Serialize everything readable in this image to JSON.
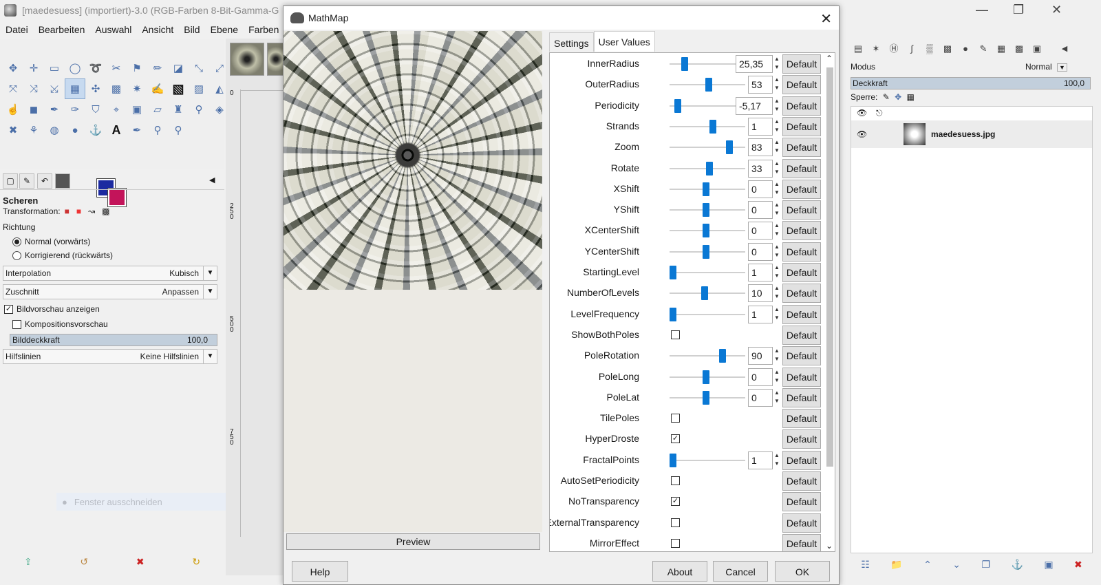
{
  "gimp": {
    "title": "[maedesuess] (importiert)-3.0 (RGB-Farben 8-Bit-Gamma-G",
    "menu": [
      "Datei",
      "Bearbeiten",
      "Auswahl",
      "Ansicht",
      "Bild",
      "Ebene",
      "Farben"
    ],
    "tool_options": {
      "header": "Scheren",
      "transformation_label": "Transformation:",
      "direction_label": "Richtung",
      "direction_options": [
        "Normal (vorwärts)",
        "Korrigierend (rückwärts)"
      ],
      "interpolation_label": "Interpolation",
      "interpolation_value": "Kubisch",
      "clip_label": "Zuschnitt",
      "clip_value": "Anpassen",
      "show_preview": "Bildvorschau anzeigen",
      "composite_preview": "Kompositionsvorschau",
      "opacity_label": "Bilddeckkraft",
      "opacity_value": "100,0",
      "guides_label": "Hilfslinien",
      "guides_value": "Keine Hilfslinien",
      "ghost_label": "Fenster ausschneiden"
    },
    "ruler_marks": [
      "0",
      "250",
      "500",
      "750"
    ],
    "fg_color": "#1c2aa0",
    "bg_color": "#c3145a"
  },
  "layers": {
    "mode_label": "Modus",
    "mode_value": "Normal",
    "opacity_label": "Deckkraft",
    "opacity_value": "100,0",
    "lock_label": "Sperre:",
    "layer_name": "maedesuess.jpg"
  },
  "dialog": {
    "title": "MathMap",
    "tabs": [
      "Settings",
      "User Values"
    ],
    "preview_button": "Preview",
    "help_button": "Help",
    "about_button": "About",
    "cancel_button": "Cancel",
    "ok_button": "OK",
    "default_label": "Default",
    "params": [
      {
        "label": "InnerRadius",
        "type": "slider",
        "value": "25,35",
        "pos": 0.17
      },
      {
        "label": "OuterRadius",
        "type": "slider",
        "value": "53",
        "pos": 0.52
      },
      {
        "label": "Periodicity",
        "type": "slider",
        "value": "-5,17",
        "pos": 0.07
      },
      {
        "label": "Strands",
        "type": "slider",
        "value": "1",
        "pos": 0.58
      },
      {
        "label": "Zoom",
        "type": "slider",
        "value": "83",
        "pos": 0.82
      },
      {
        "label": "Rotate",
        "type": "slider",
        "value": "33",
        "pos": 0.53
      },
      {
        "label": "XShift",
        "type": "slider",
        "value": "0",
        "pos": 0.48
      },
      {
        "label": "YShift",
        "type": "slider",
        "value": "0",
        "pos": 0.48
      },
      {
        "label": "XCenterShift",
        "type": "slider",
        "value": "0",
        "pos": 0.48
      },
      {
        "label": "YCenterShift",
        "type": "slider",
        "value": "0",
        "pos": 0.48
      },
      {
        "label": "StartingLevel",
        "type": "slider",
        "value": "1",
        "pos": 0.0
      },
      {
        "label": "NumberOfLevels",
        "type": "slider",
        "value": "10",
        "pos": 0.46
      },
      {
        "label": "LevelFrequency",
        "type": "slider",
        "value": "1",
        "pos": 0.0
      },
      {
        "label": "ShowBothPoles",
        "type": "check",
        "checked": false
      },
      {
        "label": "PoleRotation",
        "type": "slider",
        "value": "90",
        "pos": 0.72
      },
      {
        "label": "PoleLong",
        "type": "slider",
        "value": "0",
        "pos": 0.48
      },
      {
        "label": "PoleLat",
        "type": "slider",
        "value": "0",
        "pos": 0.48
      },
      {
        "label": "TilePoles",
        "type": "check",
        "checked": false
      },
      {
        "label": "HyperDroste",
        "type": "check",
        "checked": true
      },
      {
        "label": "FractalPoints",
        "type": "slider",
        "value": "1",
        "pos": 0.0
      },
      {
        "label": "AutoSetPeriodicity",
        "type": "check",
        "checked": false
      },
      {
        "label": "NoTransparency",
        "type": "check",
        "checked": true
      },
      {
        "label": "ExternalTransparency",
        "type": "check",
        "checked": false
      },
      {
        "label": "MirrorEffect",
        "type": "check",
        "checked": false
      }
    ]
  }
}
